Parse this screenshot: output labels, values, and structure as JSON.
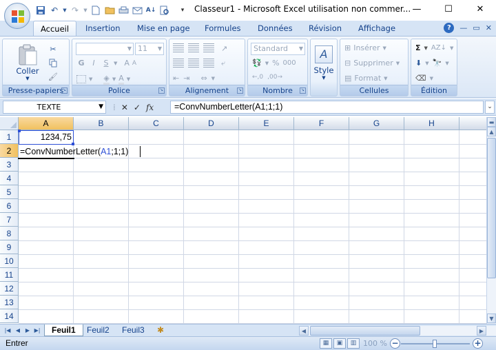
{
  "window": {
    "title": "Classeur1 - Microsoft Excel utilisation non commer...",
    "minimize_icon": "—",
    "maximize_icon": "☐",
    "close_icon": "✕"
  },
  "ribbon_tabs": [
    {
      "label": "Accueil",
      "active": true
    },
    {
      "label": "Insertion"
    },
    {
      "label": "Mise en page"
    },
    {
      "label": "Formules"
    },
    {
      "label": "Données"
    },
    {
      "label": "Révision"
    },
    {
      "label": "Affichage"
    }
  ],
  "ribbon": {
    "clipboard": {
      "label": "Presse-papiers",
      "paste_label": "Coller"
    },
    "font": {
      "label": "Police",
      "font_name": "",
      "font_size": "11",
      "bold": "G",
      "italic": "I",
      "underline": "S"
    },
    "alignment": {
      "label": "Alignement"
    },
    "number": {
      "label": "Nombre",
      "format": "Standard",
      "percent": "%",
      "thousands": "000"
    },
    "styles": {
      "label": "Style"
    },
    "cells": {
      "label": "Cellules",
      "insert": "Insérer",
      "delete": "Supprimer",
      "format": "Format"
    },
    "editing": {
      "label": "Édition"
    }
  },
  "formula_bar": {
    "name_box": "TEXTE",
    "formula": "=ConvNumberLetter(A1;1;1)",
    "cancel_symbol": "✕",
    "enter_symbol": "✓",
    "fx_label": "fx"
  },
  "grid": {
    "columns": [
      "A",
      "B",
      "C",
      "D",
      "E",
      "F",
      "G",
      "H"
    ],
    "rows": [
      "1",
      "2",
      "3",
      "4",
      "5",
      "6",
      "7",
      "8",
      "9",
      "10",
      "11",
      "12",
      "13",
      "14"
    ],
    "cells": {
      "A1": "1234,75",
      "A2_prefix": "=ConvNumberLetter(",
      "A2_ref": "A1",
      "A2_suffix": ";1;1)"
    },
    "ref_color": "#2e50d6"
  },
  "sheets": [
    {
      "label": "Feuil1",
      "active": true
    },
    {
      "label": "Feuil2"
    },
    {
      "label": "Feuil3"
    }
  ],
  "status": {
    "mode": "Entrer",
    "zoom": "100 %"
  }
}
